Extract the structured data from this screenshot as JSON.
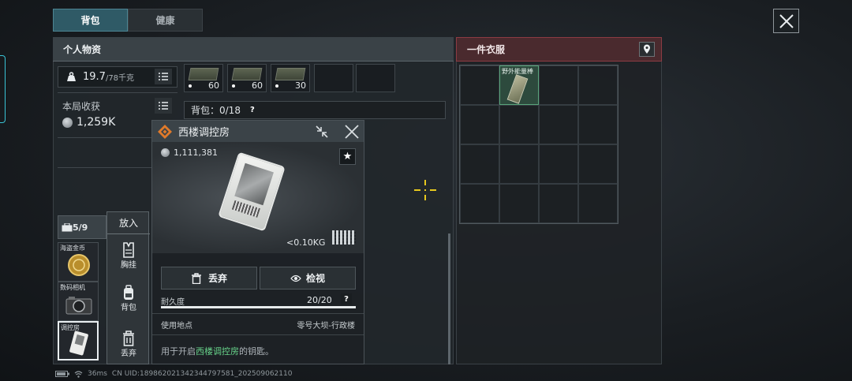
{
  "tabs": [
    {
      "label": "背包",
      "active": true
    },
    {
      "label": "健康",
      "active": false
    }
  ],
  "personal": {
    "header": "个人物资",
    "weight_value": "19.7",
    "weight_max": "/78千克",
    "loot_label": "本局收获",
    "loot_value": "1,259K"
  },
  "ammo_slots": [
    {
      "count": "60"
    },
    {
      "count": "60"
    },
    {
      "count": "30"
    }
  ],
  "bag": {
    "label": "背包：0/18",
    "help": "?"
  },
  "container": {
    "count": "5/9",
    "items": [
      {
        "label": "海盗金币"
      },
      {
        "label": "数码相机"
      },
      {
        "label": "调控房"
      }
    ]
  },
  "context_menu": {
    "title": "放入",
    "items": [
      {
        "label": "胸挂",
        "icon": "vest-icon"
      },
      {
        "label": "背包",
        "icon": "backpack-icon"
      },
      {
        "label": "丢弃",
        "icon": "trash-icon"
      }
    ]
  },
  "detail": {
    "title": "西楼调控房",
    "price": "1,111,381",
    "weight": "<0.10KG",
    "discard_label": "丢弃",
    "inspect_label": "检视",
    "durability_label": "耐久度",
    "durability_value": "20/20",
    "durability_fraction": 1.0,
    "use_label": "使用地点",
    "use_value": "零号大坝-行政楼",
    "desc_prefix": "用于开启",
    "desc_highlight": "西楼调控房",
    "desc_suffix": "的钥匙。"
  },
  "clothing": {
    "header": "一件衣服",
    "item_label": "野外能量棒"
  },
  "status": {
    "ping": "36ms",
    "uid": "CN UID:18986202134234479758​1_202509062110"
  },
  "colors": {
    "accent_teal": "#2f5a66",
    "clothing_red": "#8c3b43",
    "highlight_green": "#67d38a",
    "crosshair_yellow": "#e7c81e"
  }
}
